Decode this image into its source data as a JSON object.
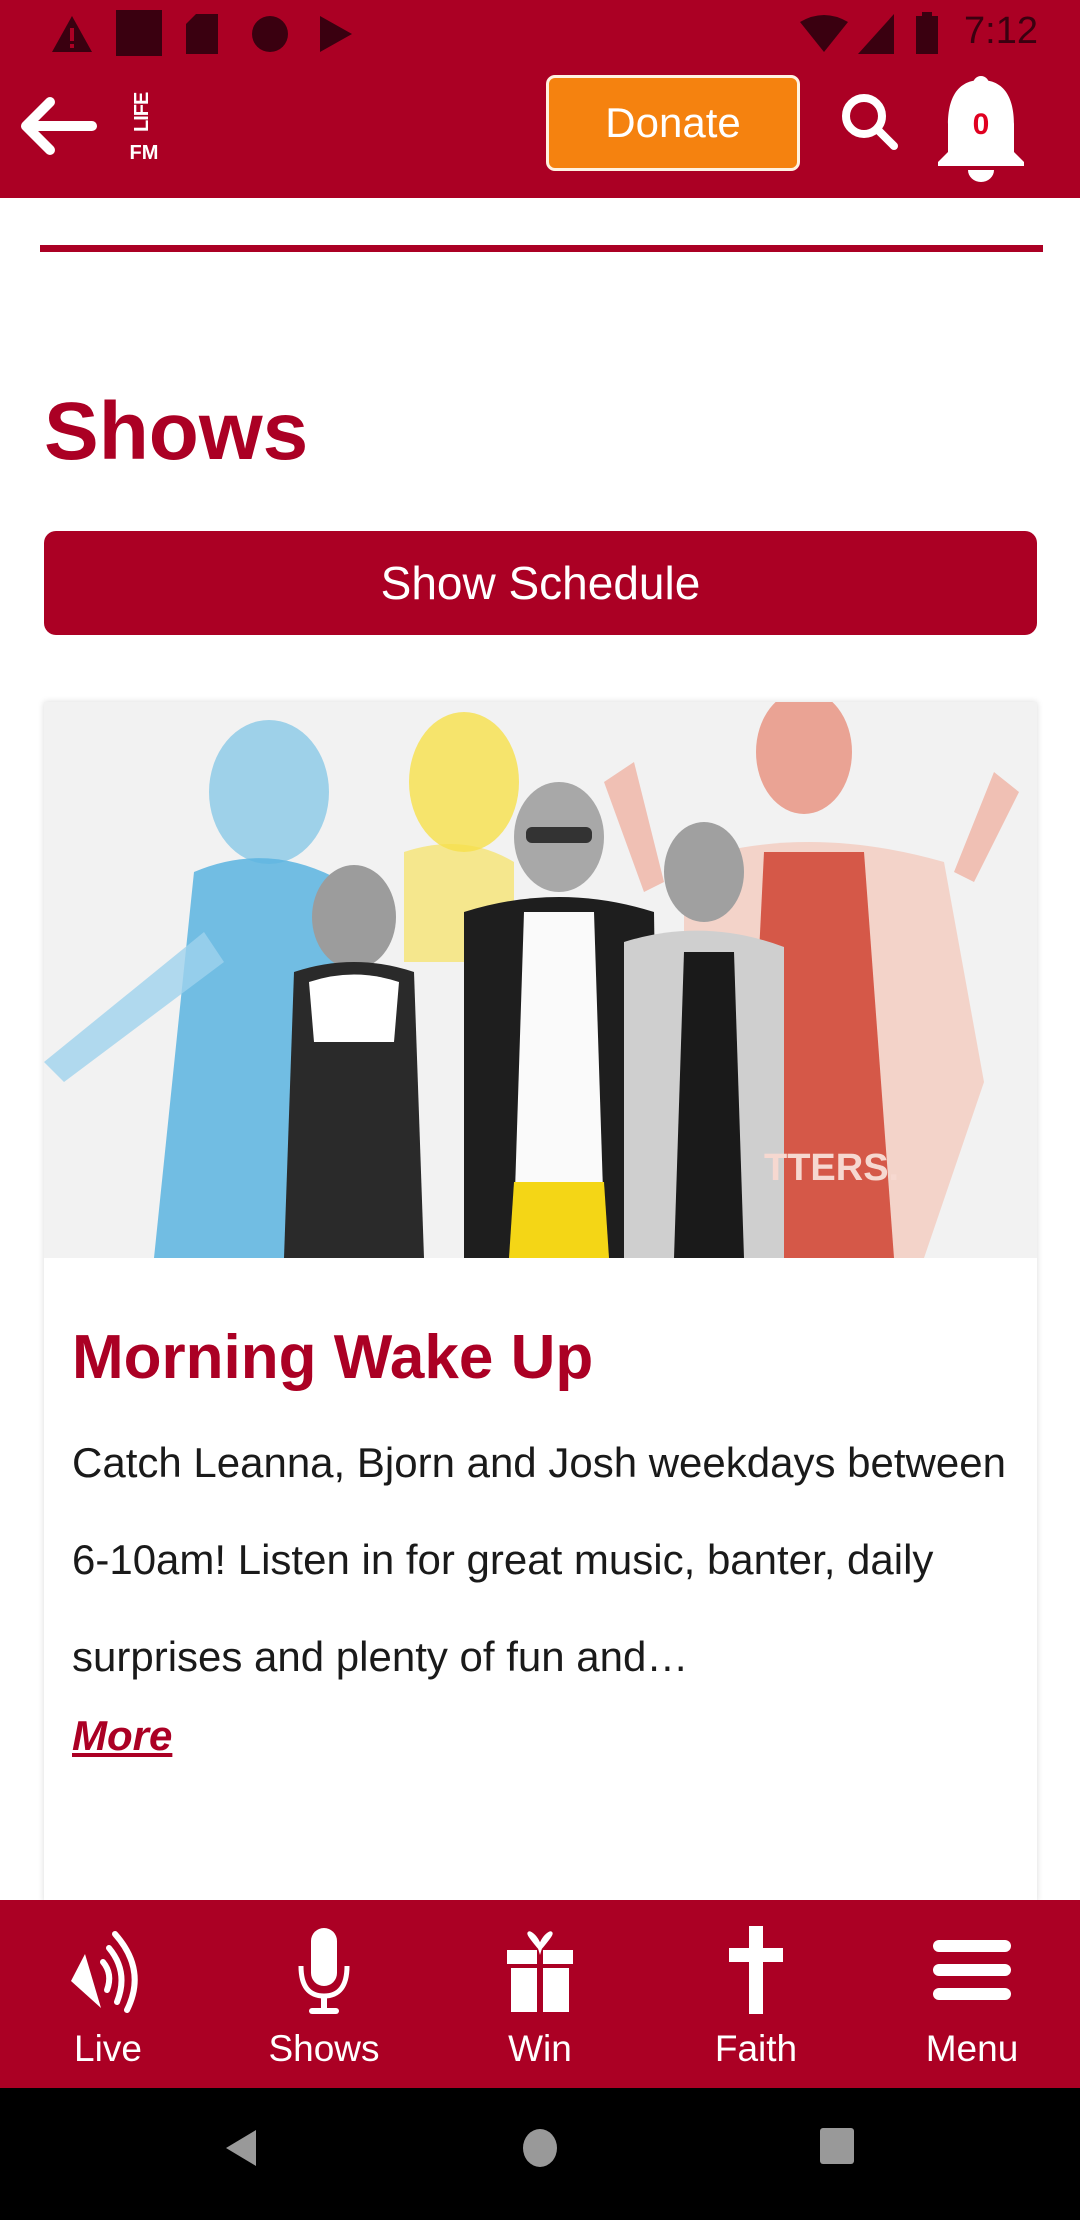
{
  "status_bar": {
    "time": "7:12",
    "left_icons": [
      "alert-icon",
      "square-icon",
      "sd-card-icon",
      "circle-icon",
      "play-store-icon"
    ],
    "right_icons": [
      "wifi-off-icon",
      "signal-icon",
      "battery-icon"
    ]
  },
  "app_bar": {
    "back_icon": "arrow-left-icon",
    "logo_text_top": "LIFE",
    "logo_text_bottom": "FM",
    "donate_label": "Donate",
    "search_icon": "search-icon",
    "notification_count": "0"
  },
  "colors": {
    "brand": "#ab0024",
    "donate": "#f5820f",
    "text": "#1a1a1a",
    "badge": "#e00020"
  },
  "page": {
    "title": "Shows",
    "schedule_button": "Show Schedule"
  },
  "show_card": {
    "image_alt": "Morning Wake Up hosts photo",
    "image_overlay_text": "TTERS.",
    "title": "Morning Wake Up",
    "description": "Catch Leanna, Bjorn and Josh weekdays between 6-10am! Listen in for great music, banter, daily surprises and plenty of fun and…",
    "more_link": "More"
  },
  "bottom_nav": {
    "items": [
      {
        "label": "Live",
        "icon": "speaker-icon"
      },
      {
        "label": "Shows",
        "icon": "microphone-icon"
      },
      {
        "label": "Win",
        "icon": "gift-icon"
      },
      {
        "label": "Faith",
        "icon": "cross-icon"
      },
      {
        "label": "Menu",
        "icon": "hamburger-menu-icon"
      }
    ]
  },
  "system_nav": [
    "back-triangle-icon",
    "home-circle-icon",
    "recents-square-icon"
  ]
}
